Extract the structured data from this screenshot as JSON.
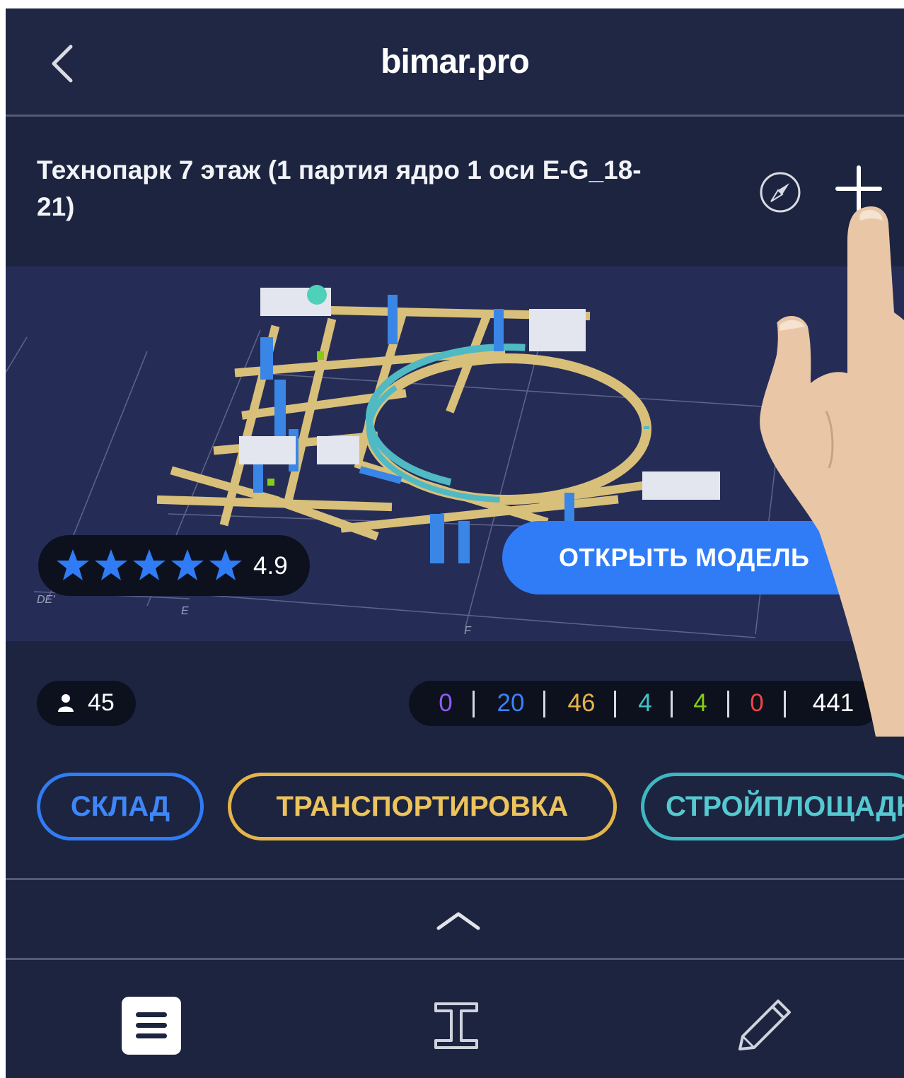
{
  "header": {
    "site_title": "bimar.pro"
  },
  "project": {
    "title": "Технопарк 7 этаж (1 партия ядро 1 оси E-G_18-21)"
  },
  "preview": {
    "rating": {
      "stars": 5,
      "value": "4.9"
    },
    "open_model_label": "ОТКРЫТЬ МОДЕЛЬ",
    "axis_labels": [
      "DE'",
      "E",
      "F"
    ]
  },
  "stats": {
    "users": "45",
    "counts": [
      {
        "value": "0",
        "color": "#8b5cf6"
      },
      {
        "value": "20",
        "color": "#3b82f6"
      },
      {
        "value": "46",
        "color": "#e5b44a"
      },
      {
        "value": "4",
        "color": "#45c1c8"
      },
      {
        "value": "4",
        "color": "#84cc16"
      },
      {
        "value": "0",
        "color": "#ef4444"
      },
      {
        "value": "441",
        "color": "#ffffff"
      }
    ]
  },
  "stages": [
    {
      "label": "СКЛАД",
      "color": "#2f7cf6"
    },
    {
      "label": "ТРАНСПОРТИРОВКА",
      "color": "#e5b44a"
    },
    {
      "label": "СТРОЙПЛОЩАДКА",
      "color": "#3fb7c0"
    }
  ],
  "icons": {
    "back": "chevron-left-icon",
    "compass": "compass-icon",
    "add": "plus-icon",
    "users": "user-icon",
    "collapse": "chevron-up-icon",
    "list": "list-icon",
    "beam": "i-beam-icon",
    "edit": "pencil-icon"
  },
  "colors": {
    "background": "#1f2744",
    "accent_blue": "#2f7cf6",
    "accent_yellow": "#e5b44a",
    "accent_teal": "#3fb7c0"
  }
}
